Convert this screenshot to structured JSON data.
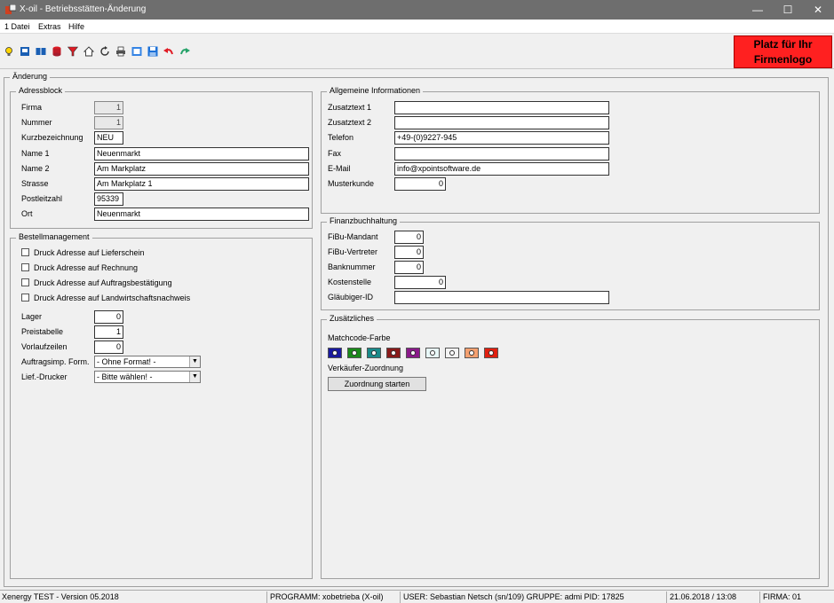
{
  "window": {
    "title": "X-oil - Betriebsstätten-Änderung",
    "min": "—",
    "max": "☐",
    "close": "✕"
  },
  "menu": [
    "1 Datei",
    "Extras",
    "Hilfe"
  ],
  "logo": {
    "line1": "Platz für Ihr",
    "line2": "Firmenlogo",
    "bg": "#ff2020"
  },
  "main": {
    "legend": "Änderung"
  },
  "address": {
    "legend": "Adressblock",
    "firma_label": "Firma",
    "firma_value": "1",
    "nummer_label": "Nummer",
    "nummer_value": "1",
    "kurz_label": "Kurzbezeichnung",
    "kurz_value": "NEU",
    "name1_label": "Name 1",
    "name1_value": "Neuenmarkt",
    "name2_label": "Name 2",
    "name2_value": "Am Markplatz",
    "strasse_label": "Strasse",
    "strasse_value": "Am Markplatz 1",
    "plz_label": "Postleitzahl",
    "plz_value": "95339",
    "ort_label": "Ort",
    "ort_value": "Neuenmarkt"
  },
  "order": {
    "legend": "Bestellmanagement",
    "cb1": "Druck Adresse auf Lieferschein",
    "cb2": "Druck Adresse auf Rechnung",
    "cb3": "Druck Adresse auf Auftragsbestätigung",
    "cb4": "Druck Adresse auf Landwirtschaftsnachweis",
    "lager_label": "Lager",
    "lager_value": "0",
    "preis_label": "Preistabelle",
    "preis_value": "1",
    "vorlauf_label": "Vorlaufzeilen",
    "vorlauf_value": "0",
    "auftrag_label": "Auftragsimp. Form.",
    "auftrag_value": "- Ohne Format! -",
    "drucker_label": "Lief.-Drucker",
    "drucker_value": "- Bitte wählen! -"
  },
  "general": {
    "legend": "Allgemeine Informationen",
    "z1_label": "Zusatztext 1",
    "z1_value": "",
    "z2_label": "Zusatztext 2",
    "z2_value": "",
    "tel_label": "Telefon",
    "tel_value": "+49-(0)9227-945",
    "fax_label": "Fax",
    "fax_value": "",
    "mail_label": "E-Mail",
    "mail_value": "info@xpointsoftware.de",
    "muster_label": "Musterkunde",
    "muster_value": "0"
  },
  "finance": {
    "legend": "Finanzbuchhaltung",
    "mandant_label": "FiBu-Mandant",
    "mandant_value": "0",
    "vertreter_label": "FiBu-Vertreter",
    "vertreter_value": "0",
    "bank_label": "Banknummer",
    "bank_value": "0",
    "kosten_label": "Kostenstelle",
    "kosten_value": "0",
    "glaub_label": "Gläubiger-ID",
    "glaub_value": ""
  },
  "extra": {
    "legend": "Zusätzliches",
    "match_label": "Matchcode-Farbe",
    "swatches": [
      "#1a1aa0",
      "#1a8a1a",
      "#1a8a8a",
      "#8a1a1a",
      "#8a1a8a",
      "#e8f8f8",
      "#f4f4f4",
      "#f4a070",
      "#e02010"
    ],
    "verk_label": "Verkäufer-Zuordnung",
    "button": "Zuordnung starten"
  },
  "status": {
    "version": "Xenergy TEST - Version 05.2018",
    "programm": "PROGRAMM: xobetrieba (X-oil)",
    "user": "USER: Sebastian Netsch (sn/109)  GRUPPE: admi  PID: 17825",
    "datetime": "21.06.2018 / 13:08",
    "firma": "FIRMA: 01"
  }
}
